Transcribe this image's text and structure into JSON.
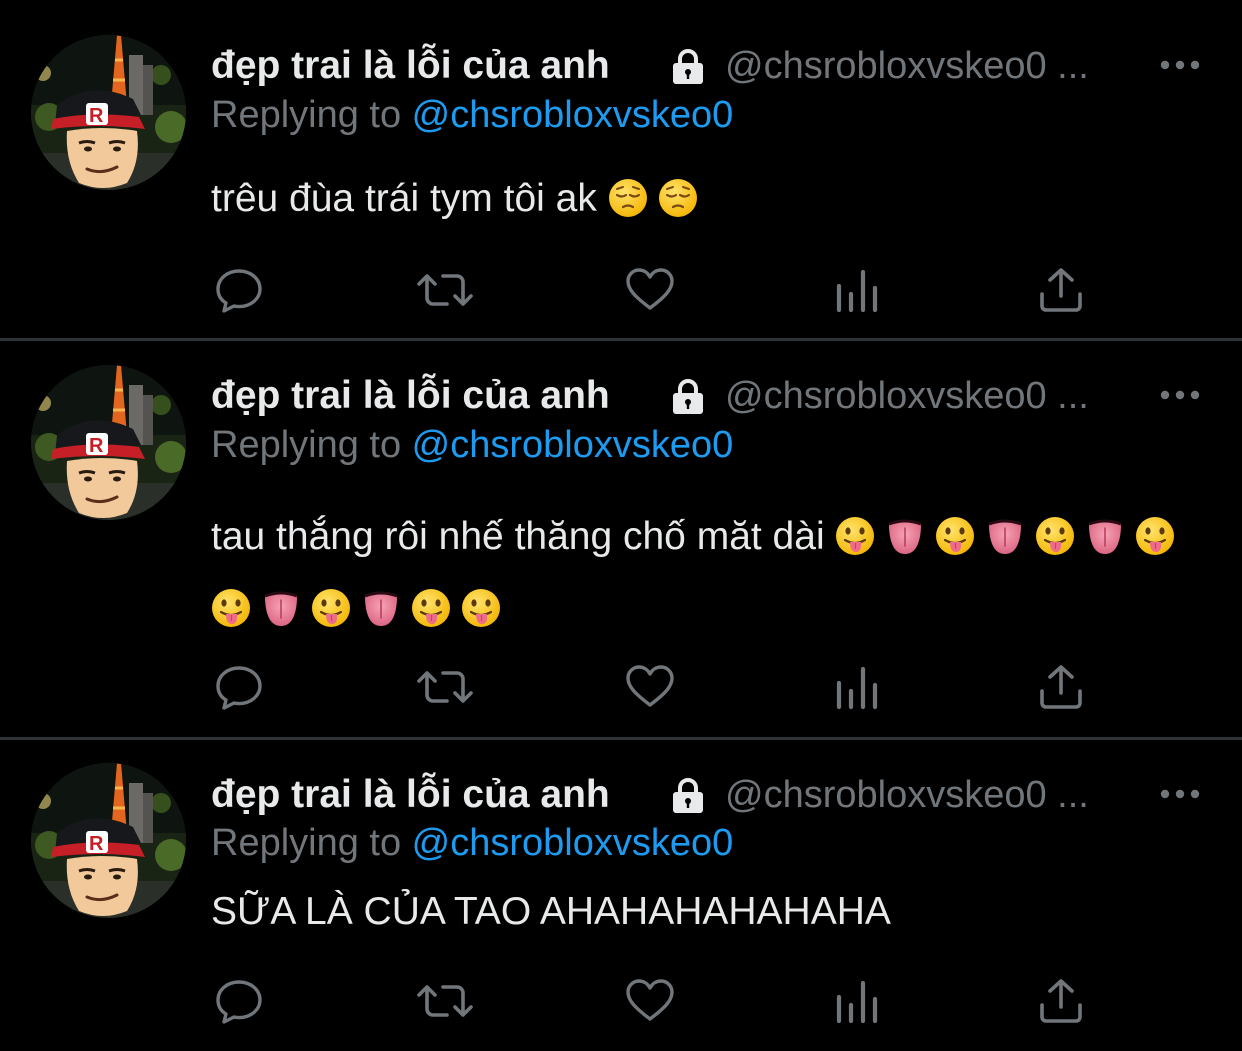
{
  "colors": {
    "background": "#000000",
    "divider": "#2f3336",
    "name_text": "#e7e9ea",
    "secondary_text": "#71767b",
    "link": "#1d9bf0"
  },
  "icons": {
    "lock": "lock-icon",
    "more": "more-icon",
    "reply": "reply-icon",
    "retweet": "retweet-icon",
    "like": "heart-icon",
    "views": "analytics-icon",
    "share": "share-icon"
  },
  "tweets": [
    {
      "display_name": "đẹp trai là lỗi của anh",
      "handle": "@chsrobloxvskeo0 ...",
      "reply_prefix": "Replying to ",
      "reply_handle": "@chsrobloxvskeo0",
      "text": "trêu đùa trái tym tôi ak",
      "emojis": [
        "pensive-face",
        "pensive-face"
      ]
    },
    {
      "display_name": "đẹp trai là lỗi của anh",
      "handle": "@chsrobloxvskeo0 ...",
      "reply_prefix": "Replying to ",
      "reply_handle": "@chsrobloxvskeo0",
      "text": "tau thắng rôi nhế thăng chố măt dài",
      "emojis": [
        "tongue-face",
        "tongue",
        "tongue-face",
        "tongue",
        "tongue-face",
        "tongue",
        "tongue-face",
        "tongue-face",
        "tongue",
        "tongue-face",
        "tongue",
        "tongue-face",
        "tongue-face"
      ]
    },
    {
      "display_name": "đẹp trai là lỗi của anh",
      "handle": "@chsrobloxvskeo0 ...",
      "reply_prefix": "Replying to ",
      "reply_handle": "@chsrobloxvskeo0",
      "text": "SỮA LÀ CỦA TAO AHAHAHAHAHAHA",
      "emojis": []
    }
  ]
}
